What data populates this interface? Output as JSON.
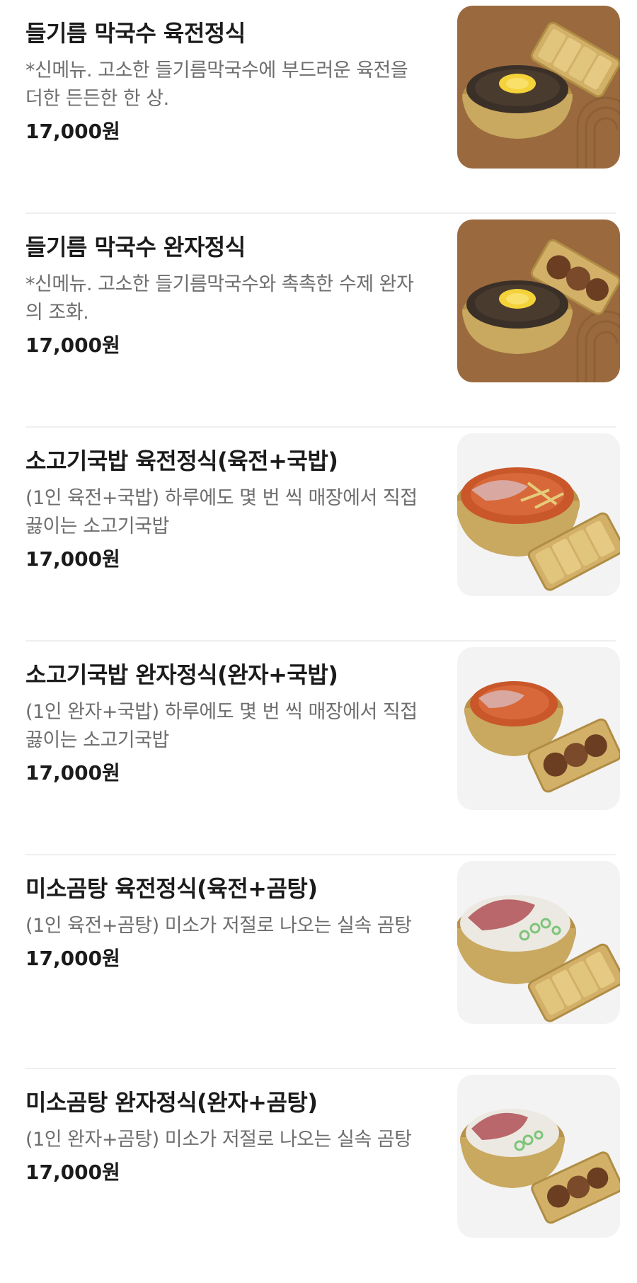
{
  "menu": {
    "items": [
      {
        "name": "들기름 막국수 육전정식",
        "description": "*신메뉴. 고소한 들기름막국수에 부드러운 육전을 더한 든든한 한 상.",
        "price": "17,000원",
        "image": "noodle-with-yukjeon"
      },
      {
        "name": "들기름 막국수 완자정식",
        "description": "*신메뉴. 고소한 들기름막국수와 촉촉한 수제 완자의 조화.",
        "price": "17,000원",
        "image": "noodle-with-wanja"
      },
      {
        "name": "소고기국밥 육전정식(육전+국밥)",
        "description": "(1인 육전+국밥) 하루에도 몇 번 씩 매장에서 직접 끓이는 소고기국밥",
        "price": "17,000원",
        "image": "gukbap-with-yukjeon"
      },
      {
        "name": "소고기국밥 완자정식(완자+국밥)",
        "description": "(1인 완자+국밥) 하루에도 몇 번 씩 매장에서 직접 끓이는 소고기국밥",
        "price": "17,000원",
        "image": "gukbap-with-wanja"
      },
      {
        "name": "미소곰탕 육전정식(육전+곰탕)",
        "description": "(1인 육전+곰탕) 미소가 저절로 나오는 실속 곰탕",
        "price": "17,000원",
        "image": "gomtang-with-yukjeon"
      },
      {
        "name": "미소곰탕 완자정식(완자+곰탕)",
        "description": "(1인 완자+곰탕) 미소가 저절로 나오는 실속 곰탕",
        "price": "17,000원",
        "image": "gomtang-with-wanja"
      }
    ]
  },
  "colors": {
    "thumb_brown": "#9a6a3e",
    "thumb_gray": "#f3f3f3",
    "brass": "#c9a85f",
    "price": "#1b1b1b",
    "description": "#6e6e6e"
  }
}
